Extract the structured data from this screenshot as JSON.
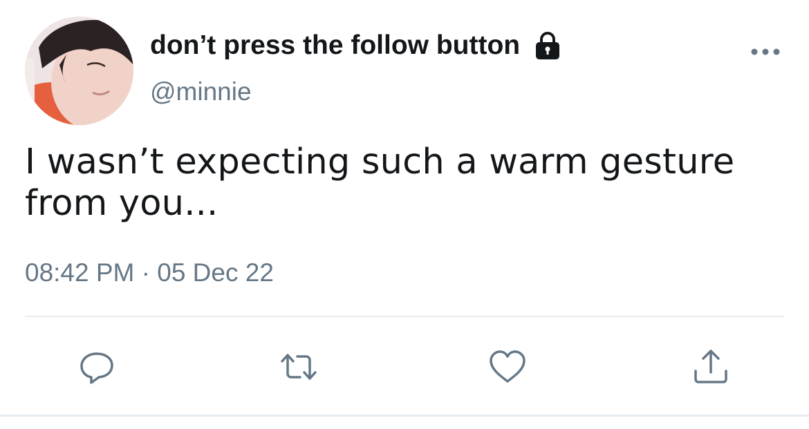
{
  "tweet": {
    "display_name": "don’t press the follow button",
    "handle": "@minnie",
    "text": "I wasn’t expecting such a warm gesture from you...",
    "timestamp": "08:42 PM · 05 Dec 22",
    "protected_icon": "lock-icon",
    "more_icon": "more-options-icon"
  },
  "actions": {
    "reply_icon": "reply-icon",
    "retweet_icon": "retweet-icon",
    "like_icon": "heart-icon",
    "share_icon": "share-icon"
  },
  "colors": {
    "text_primary": "#14171a",
    "text_secondary": "#657786",
    "icon": "#657786",
    "divider": "#e6ecf0"
  }
}
